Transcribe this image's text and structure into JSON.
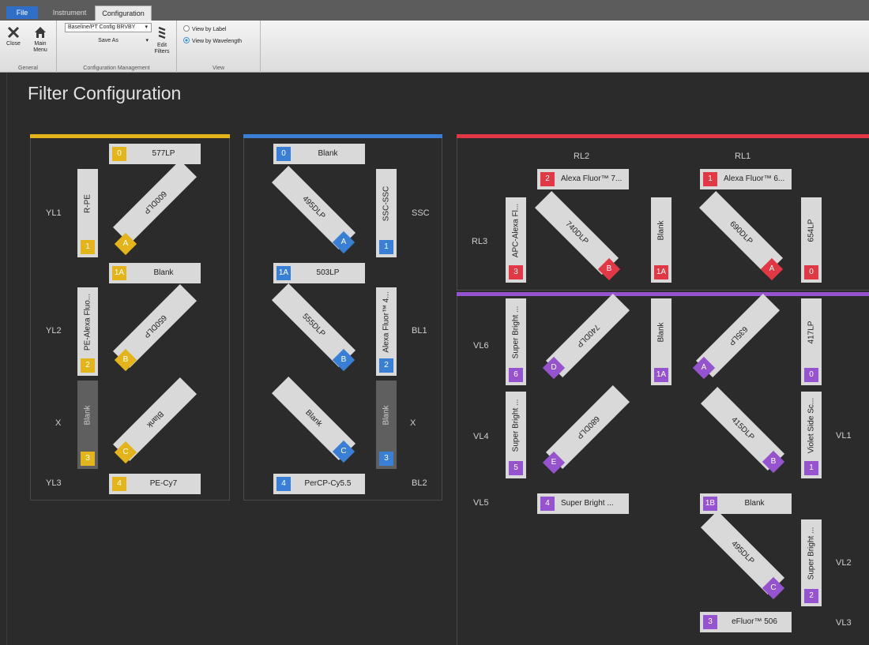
{
  "ribbon": {
    "tabs": [
      "File",
      "Instrument",
      "Configuration"
    ],
    "active_tab": "Configuration",
    "general": {
      "close_label": "Close",
      "main_menu_label_1": "Main",
      "main_menu_label_2": "Menu",
      "group_label": "General"
    },
    "config_mgmt": {
      "config_value": "Baseline/PT Config BRVBY",
      "save_as_label": "Save As",
      "edit_filters_label_1": "Edit",
      "edit_filters_label_2": "Filters",
      "group_label": "Configuration Management"
    },
    "view": {
      "option_label": "View by Label",
      "option_wavelength": "View by Wavelength",
      "selected": "View by Wavelength",
      "group_label": "View"
    }
  },
  "page_title": "Filter Configuration",
  "laser_colors": {
    "yellow": "#e3b51a",
    "blue": "#3a7fd6",
    "red": "#e23845",
    "violet": "#9653cf"
  },
  "yellow_laser": {
    "channel_labels": [
      "YL1",
      "YL2",
      "X",
      "YL3"
    ],
    "filters": [
      {
        "badge": "0",
        "text": "577LP"
      },
      {
        "badge": "1",
        "text": "R-PE"
      },
      {
        "badge": "1A",
        "text": "Blank"
      },
      {
        "badge": "2",
        "text": "PE-Alexa Fluo..."
      },
      {
        "badge": "3",
        "text": "Blank"
      },
      {
        "badge": "4",
        "text": "PE-Cy7"
      }
    ],
    "dichroics": [
      {
        "letter": "A",
        "text": "600DLP"
      },
      {
        "letter": "B",
        "text": "650DLP"
      },
      {
        "letter": "C",
        "text": "Blank"
      }
    ]
  },
  "blue_laser": {
    "channel_labels": [
      "SSC",
      "BL1",
      "X",
      "BL2"
    ],
    "filters": [
      {
        "badge": "0",
        "text": "Blank"
      },
      {
        "badge": "1",
        "text": "SSC-SSC"
      },
      {
        "badge": "1A",
        "text": "503LP"
      },
      {
        "badge": "2",
        "text": "Alexa Fluor™ 4..."
      },
      {
        "badge": "3",
        "text": "Blank"
      },
      {
        "badge": "4",
        "text": "PerCP-Cy5.5"
      }
    ],
    "dichroics": [
      {
        "letter": "A",
        "text": "495DLP"
      },
      {
        "letter": "B",
        "text": "555DLP"
      },
      {
        "letter": "C",
        "text": "Blank"
      }
    ]
  },
  "red_laser": {
    "channel_labels": [
      "RL2",
      "RL1",
      "RL3"
    ],
    "filters": [
      {
        "badge": "2",
        "text": "Alexa Fluor™ 7..."
      },
      {
        "badge": "1",
        "text": "Alexa Fluor™ 6..."
      },
      {
        "badge": "3",
        "text": "APC-Alexa Fl..."
      },
      {
        "badge": "1A",
        "text": "Blank"
      },
      {
        "badge": "0",
        "text": "654LP"
      }
    ],
    "dichroics": [
      {
        "letter": "B",
        "text": "740DLP"
      },
      {
        "letter": "A",
        "text": "690DLP"
      }
    ]
  },
  "violet_laser": {
    "channel_labels": [
      "VL6",
      "VL4",
      "VL5",
      "VL1",
      "VL2",
      "VL3"
    ],
    "filters": [
      {
        "badge": "6",
        "text": "Super Bright ..."
      },
      {
        "badge": "1A",
        "text": "Blank"
      },
      {
        "badge": "0",
        "text": "417LP"
      },
      {
        "badge": "5",
        "text": "Super Bright ..."
      },
      {
        "badge": "1",
        "text": "Violet Side Sc..."
      },
      {
        "badge": "4",
        "text": "Super Bright ..."
      },
      {
        "badge": "1B",
        "text": "Blank"
      },
      {
        "badge": "2",
        "text": "Super Bright ..."
      },
      {
        "badge": "3",
        "text": "eFluor™ 506"
      }
    ],
    "dichroics": [
      {
        "letter": "D",
        "text": "740DLP"
      },
      {
        "letter": "A",
        "text": "635LP"
      },
      {
        "letter": "E",
        "text": "680DLP"
      },
      {
        "letter": "B",
        "text": "415DLP"
      },
      {
        "letter": "C",
        "text": "495DLP"
      }
    ]
  }
}
